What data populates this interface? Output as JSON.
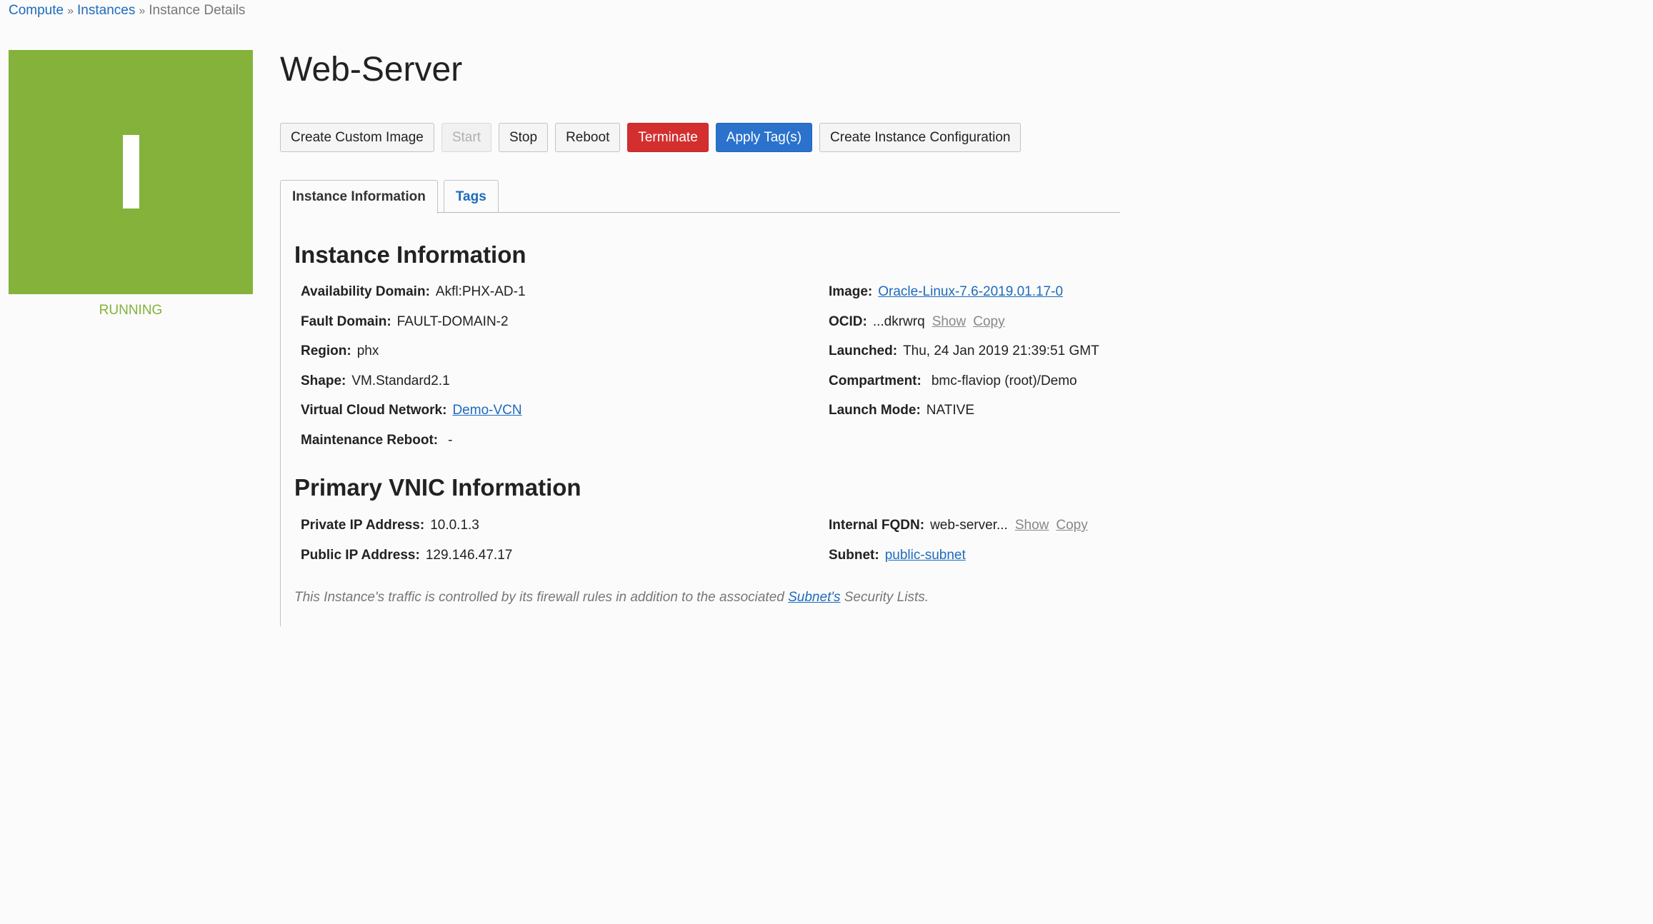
{
  "breadcrumb": {
    "compute": "Compute",
    "instances": "Instances",
    "current": "Instance Details",
    "separator": "»"
  },
  "status": {
    "letter": "I",
    "text": "RUNNING",
    "color": "#84b23a"
  },
  "title": "Web-Server",
  "toolbar": {
    "create_custom_image": "Create Custom Image",
    "start": "Start",
    "stop": "Stop",
    "reboot": "Reboot",
    "terminate": "Terminate",
    "apply_tags": "Apply Tag(s)",
    "create_instance_configuration": "Create Instance Configuration"
  },
  "tabs": {
    "instance_information": "Instance Information",
    "tags": "Tags"
  },
  "instance_info": {
    "heading": "Instance Information",
    "availability_domain": {
      "label": "Availability Domain:",
      "value": "Akfl:PHX-AD-1"
    },
    "fault_domain": {
      "label": "Fault Domain:",
      "value": "FAULT-DOMAIN-2"
    },
    "region": {
      "label": "Region:",
      "value": "phx"
    },
    "shape": {
      "label": "Shape:",
      "value": "VM.Standard2.1"
    },
    "vcn": {
      "label": "Virtual Cloud Network:",
      "value": "Demo-VCN"
    },
    "maintenance_reboot": {
      "label": "Maintenance Reboot:",
      "value": "-"
    },
    "image": {
      "label": "Image:",
      "value": "Oracle-Linux-7.6-2019.01.17-0"
    },
    "ocid": {
      "label": "OCID:",
      "value": "...dkrwrq",
      "show": "Show",
      "copy": "Copy"
    },
    "launched": {
      "label": "Launched:",
      "value": "Thu, 24 Jan 2019 21:39:51 GMT"
    },
    "compartment": {
      "label": "Compartment:",
      "value": "bmc-flaviop (root)/Demo"
    },
    "launch_mode": {
      "label": "Launch Mode:",
      "value": "NATIVE"
    }
  },
  "vnic_info": {
    "heading": "Primary VNIC Information",
    "private_ip": {
      "label": "Private IP Address:",
      "value": "10.0.1.3"
    },
    "public_ip": {
      "label": "Public IP Address:",
      "value": "129.146.47.17"
    },
    "internal_fqdn": {
      "label": "Internal FQDN:",
      "value": "web-server...",
      "show": "Show",
      "copy": "Copy"
    },
    "subnet": {
      "label": "Subnet:",
      "value": "public-subnet"
    }
  },
  "footnote": {
    "before": "This Instance's traffic is controlled by its firewall rules in addition to the associated ",
    "link": "Subnet's",
    "after": " Security Lists."
  },
  "colors": {
    "running_green": "#84b23a",
    "link_blue": "#1d6bbd",
    "terminate_red": "#d32f2f",
    "primary_blue": "#2a72cc"
  }
}
